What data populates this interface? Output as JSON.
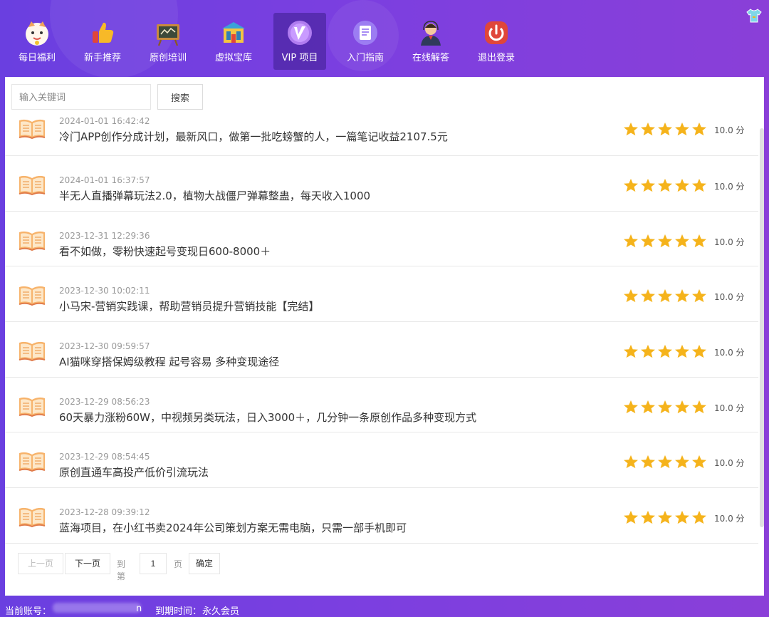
{
  "nav": {
    "items": [
      {
        "label": "每日福利",
        "icon": "lucky-cat-icon"
      },
      {
        "label": "新手推荐",
        "icon": "thumbs-up-icon"
      },
      {
        "label": "原创培训",
        "icon": "blackboard-icon"
      },
      {
        "label": "虚拟宝库",
        "icon": "treasure-building-icon"
      },
      {
        "label": "VIP 项目",
        "icon": "vip-badge-icon",
        "active": true
      },
      {
        "label": "入门指南",
        "icon": "document-icon"
      },
      {
        "label": "在线解答",
        "icon": "support-agent-icon"
      },
      {
        "label": "退出登录",
        "icon": "power-icon"
      }
    ],
    "skin_icon": "tshirt-icon"
  },
  "search": {
    "placeholder": "输入关键词",
    "button_label": "搜索"
  },
  "list": {
    "items": [
      {
        "time": "2024-01-01 16:42:42",
        "title": "冷门APP创作分成计划，最新风口，做第一批吃螃蟹的人，一篇笔记收益2107.5元",
        "rating": 5,
        "score": "10.0 分"
      },
      {
        "time": "2024-01-01 16:37:57",
        "title": "半无人直播弹幕玩法2.0，植物大战僵尸弹幕整蛊，每天收入1000",
        "rating": 5,
        "score": "10.0 分"
      },
      {
        "time": "2023-12-31 12:29:36",
        "title": "看不如做，零粉快速起号变现日600-8000＋",
        "rating": 5,
        "score": "10.0 分"
      },
      {
        "time": "2023-12-30 10:02:11",
        "title": "小马宋-营销实践课，帮助营销员提升营销技能【完结】",
        "rating": 5,
        "score": "10.0 分"
      },
      {
        "time": "2023-12-30 09:59:57",
        "title": "AI猫咪穿搭保姆级教程 起号容易 多种变现途径",
        "rating": 5,
        "score": "10.0 分"
      },
      {
        "time": "2023-12-29 08:56:23",
        "title": "60天暴力涨粉60W，中视频另类玩法，日入3000＋，几分钟一条原创作品多种变现方式",
        "rating": 5,
        "score": "10.0 分"
      },
      {
        "time": "2023-12-29 08:54:45",
        "title": "原创直通车高投产低价引流玩法",
        "rating": 5,
        "score": "10.0 分"
      },
      {
        "time": "2023-12-28 09:39:12",
        "title": "蓝海项目，在小红书卖2024年公司策划方案无需电脑，只需一部手机即可",
        "rating": 5,
        "score": "10.0 分"
      }
    ]
  },
  "pager": {
    "prev": "上一页",
    "next": "下一页",
    "goto_prefix": "到第",
    "page_value": "1",
    "goto_suffix": "页",
    "confirm": "确定"
  },
  "footer": {
    "account_label": "当前账号：",
    "account_tail": "n",
    "expiry_label": "到期时间：",
    "expiry_value": "永久会员"
  },
  "colors": {
    "star": "#f5b31b",
    "book": "#f4a261",
    "accent": "#7b3fe0"
  }
}
